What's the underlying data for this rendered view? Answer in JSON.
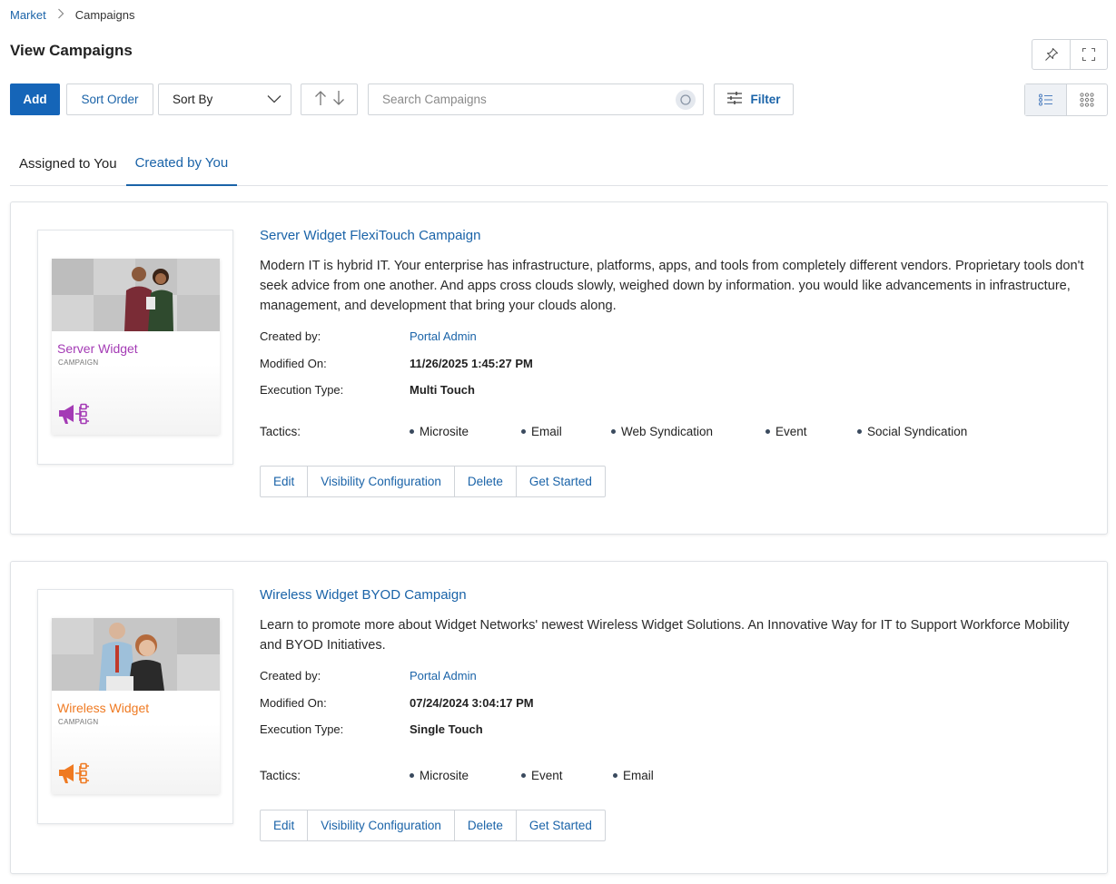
{
  "breadcrumb": {
    "parent": "Market",
    "current": "Campaigns"
  },
  "page": {
    "title": "View Campaigns"
  },
  "toolbar": {
    "add_label": "Add",
    "sort_order_label": "Sort Order",
    "sort_by_value": "Sort By",
    "search_placeholder": "Search Campaigns",
    "filter_label": "Filter"
  },
  "tabs": [
    {
      "label": "Assigned to You",
      "active": false
    },
    {
      "label": "Created by You",
      "active": true
    }
  ],
  "labels": {
    "created_by": "Created by:",
    "modified_on": "Modified On:",
    "execution_type": "Execution Type:",
    "tactics": "Tactics:"
  },
  "actions": {
    "edit": "Edit",
    "visibility": "Visibility Configuration",
    "delete": "Delete",
    "get_started": "Get Started"
  },
  "campaigns": [
    {
      "title": "Server Widget FlexiTouch Campaign",
      "description": "Modern IT is hybrid IT. Your enterprise has infrastructure, platforms, apps, and tools from completely different vendors. Proprietary tools don't seek advice from one another. And apps cross clouds slowly, weighed down by information. you would like advancements in infrastructure, management, and development that bring your clouds along.",
      "created_by": "Portal Admin",
      "modified_on": "11/26/2025 1:45:27 PM",
      "execution_type": "Multi Touch",
      "tactics": [
        "Microsite",
        "Email",
        "Web Syndication",
        "Event",
        "Social Syndication"
      ],
      "thumb_title": "Server Widget",
      "thumb_sub": "CAMPAIGN",
      "accent": "#a43bb5"
    },
    {
      "title": "Wireless Widget BYOD Campaign",
      "description": "Learn to promote more about Widget Networks' newest Wireless Widget Solutions. An Innovative Way for IT to Support Workforce Mobility and BYOD Initiatives.",
      "created_by": "Portal Admin",
      "modified_on": "07/24/2024 3:04:17 PM",
      "execution_type": "Single Touch",
      "tactics": [
        "Microsite",
        "Event",
        "Email"
      ],
      "thumb_title": "Wireless Widget",
      "thumb_sub": "CAMPAIGN",
      "accent": "#ef7a22"
    }
  ]
}
